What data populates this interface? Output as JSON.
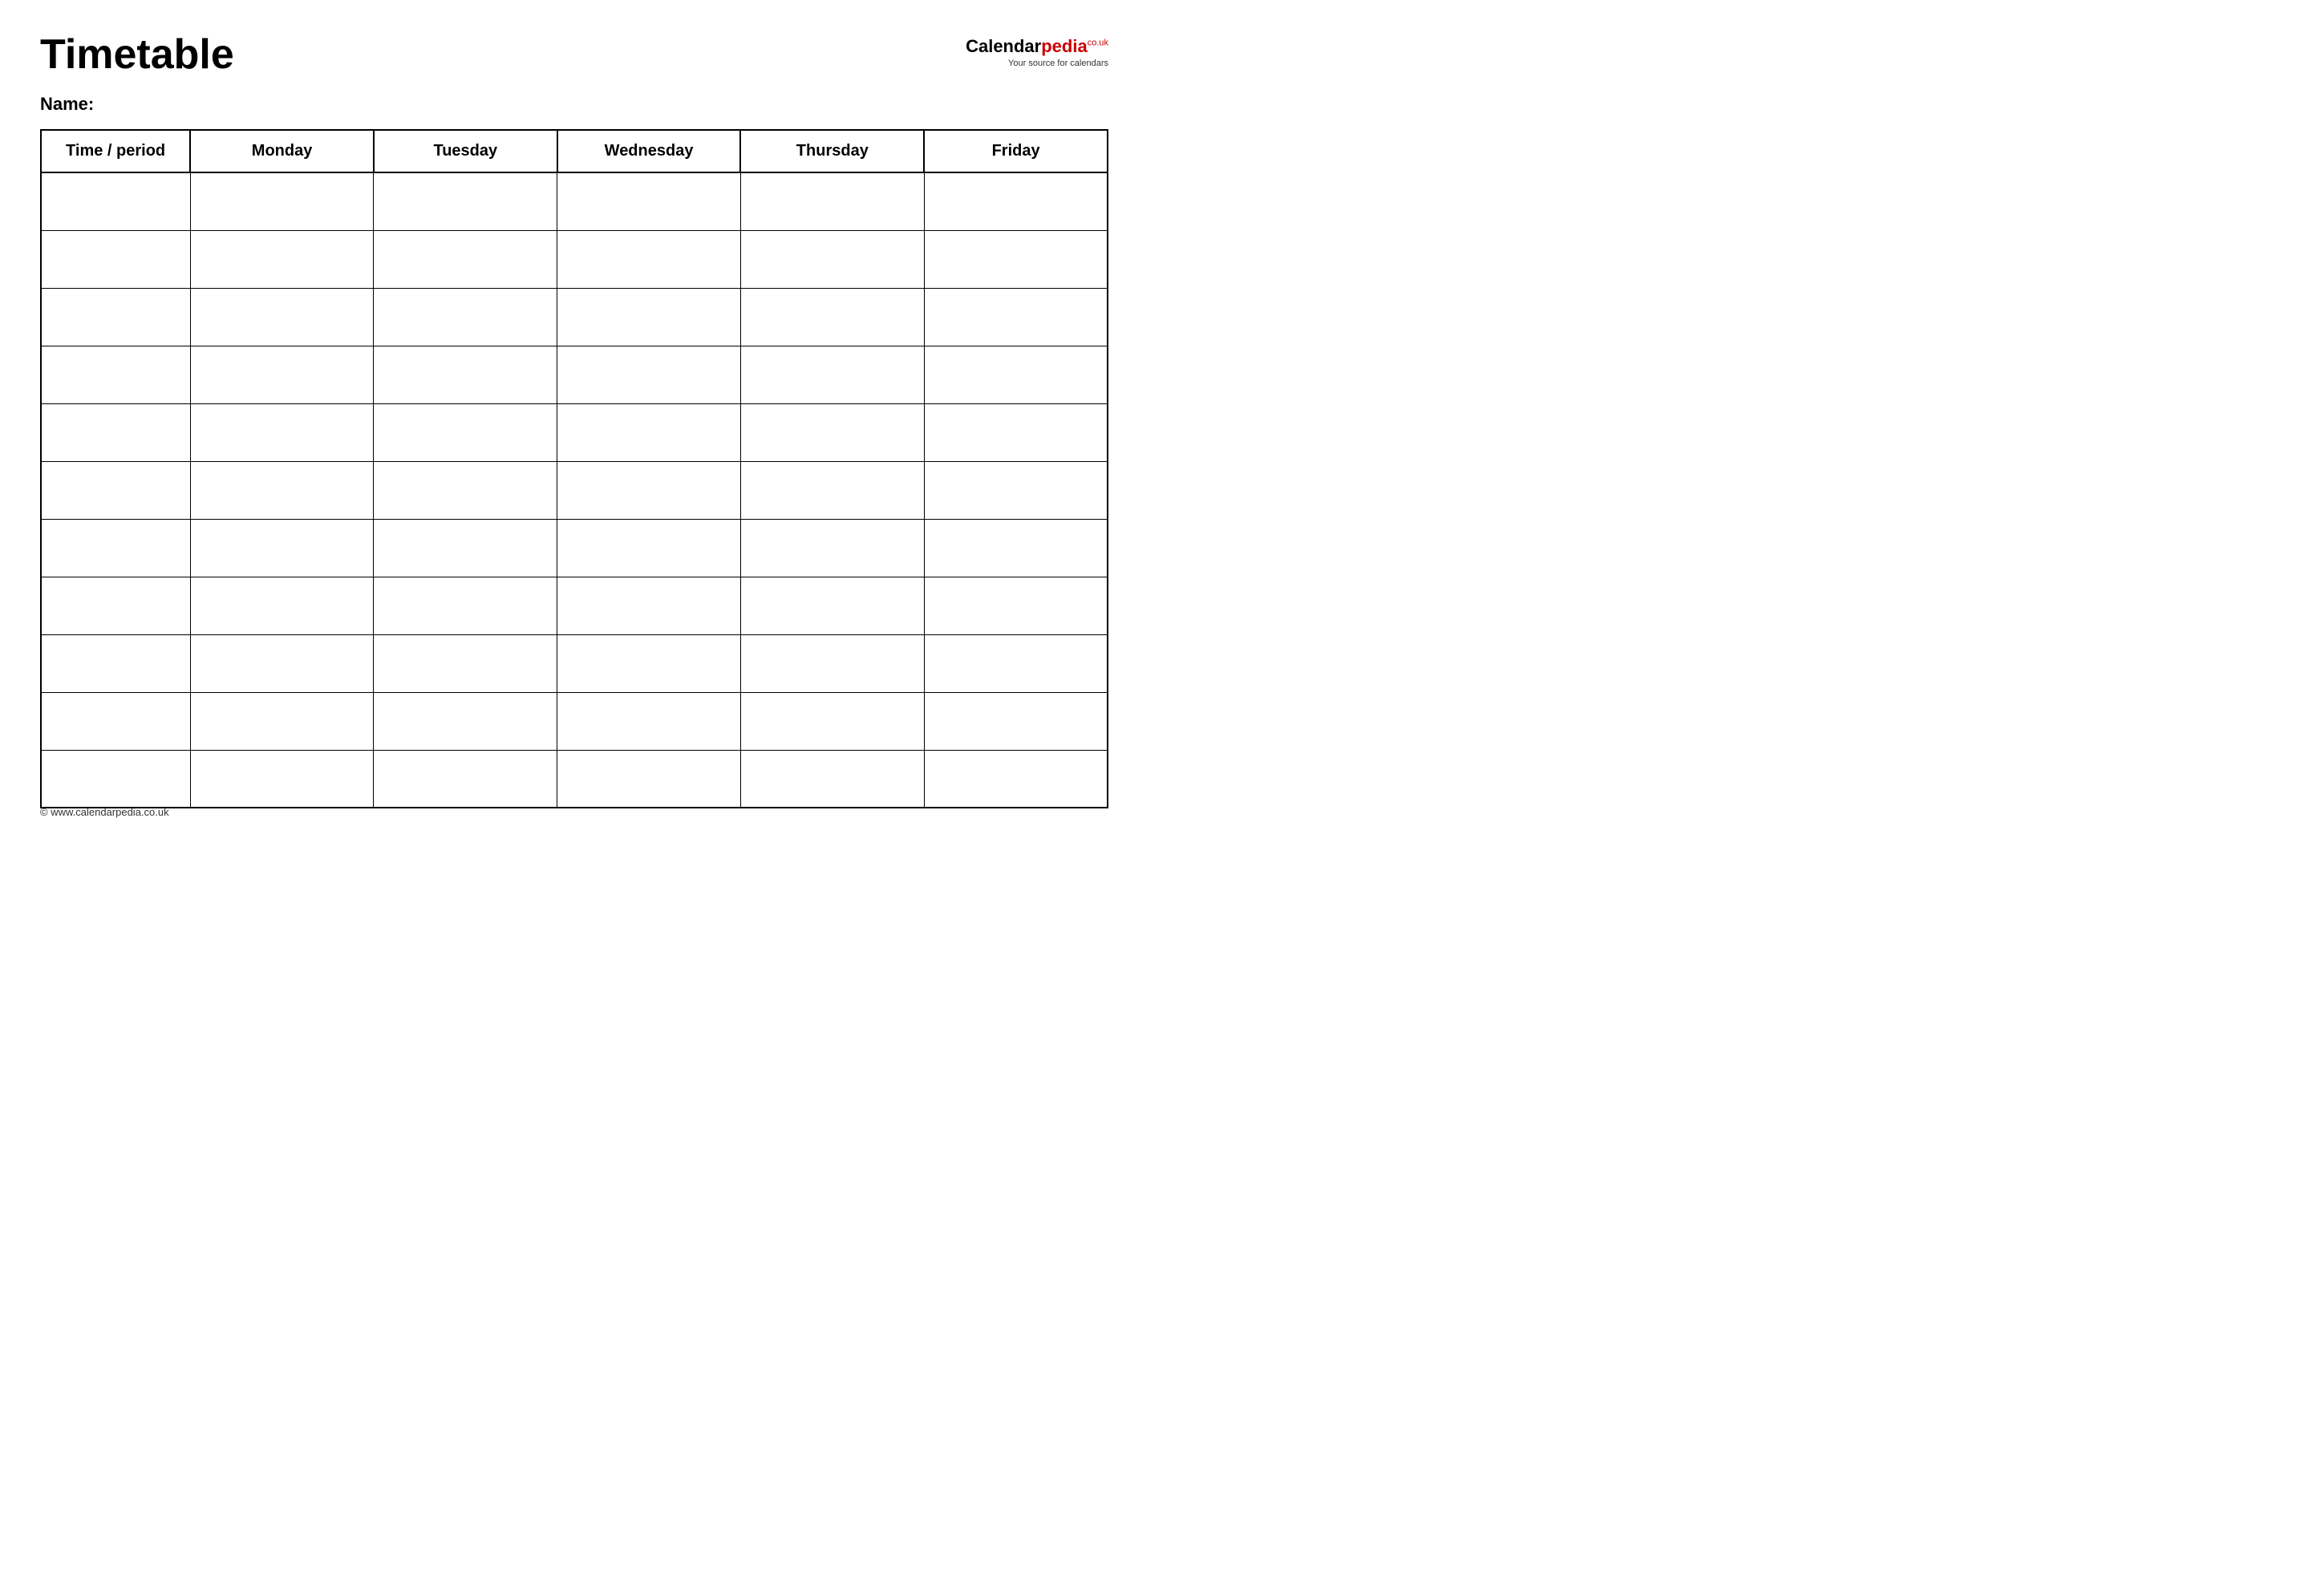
{
  "header": {
    "title": "Timetable",
    "logo": {
      "calendar": "Calendar",
      "pedia": "pedia",
      "co_uk": "co.uk",
      "subtitle": "Your source for calendars"
    }
  },
  "name_label": "Name:",
  "table": {
    "columns": [
      "Time / period",
      "Monday",
      "Tuesday",
      "Wednesday",
      "Thursday",
      "Friday"
    ],
    "rows": 11
  },
  "footer": {
    "url": "© www.calendarpedia.co.uk"
  }
}
